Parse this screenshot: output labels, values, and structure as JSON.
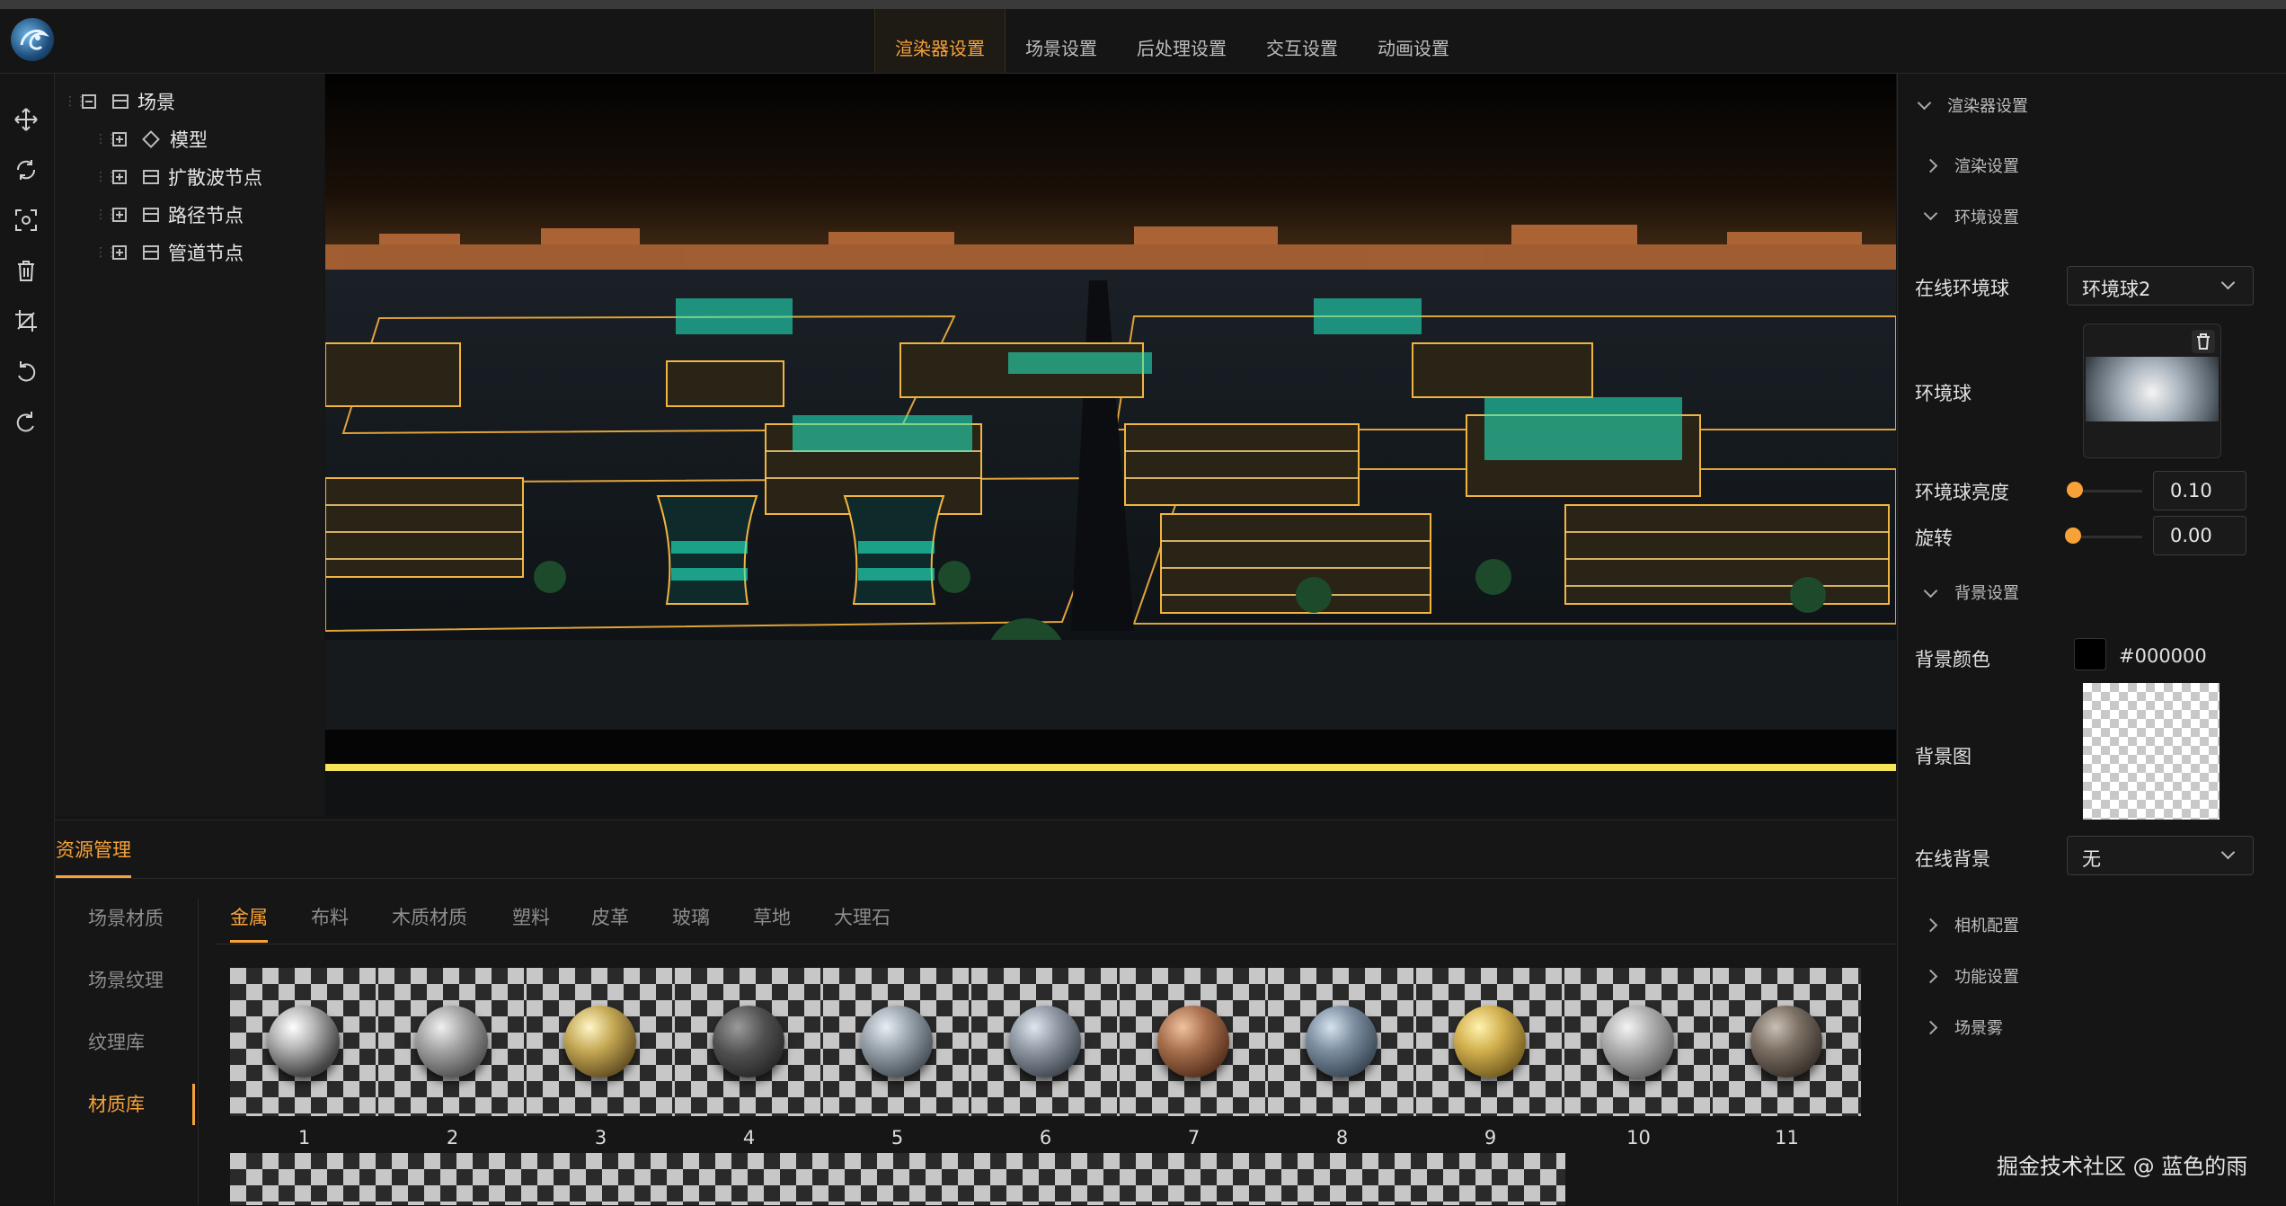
{
  "header": {
    "tabs": [
      {
        "label": "渲染器设置",
        "active": true
      },
      {
        "label": "场景设置"
      },
      {
        "label": "后处理设置"
      },
      {
        "label": "交互设置"
      },
      {
        "label": "动画设置"
      }
    ]
  },
  "toolbar": {
    "tools": [
      "move-icon",
      "rotate-icon",
      "scale-icon",
      "delete-icon",
      "crop-icon",
      "undo-icon",
      "redo-icon"
    ]
  },
  "tree": {
    "root": "场景",
    "children": [
      "模型",
      "扩散波节点",
      "路径节点",
      "管道节点"
    ]
  },
  "resources": {
    "title": "资源管理",
    "side": [
      "场景材质",
      "场景纹理",
      "纹理库",
      "材质库"
    ],
    "active_side": "材质库",
    "tabs": [
      "金属",
      "布料",
      "木质材质",
      "塑料",
      "皮革",
      "玻璃",
      "草地",
      "大理石"
    ],
    "active_tab": "金属",
    "materials": [
      "1",
      "2",
      "3",
      "4",
      "5",
      "6",
      "7",
      "8",
      "9",
      "10",
      "11"
    ]
  },
  "right_panel": {
    "renderer_settings": "渲染器设置",
    "render_settings": "渲染设置",
    "env_settings": "环境设置",
    "online_env_label": "在线环境球",
    "online_env_value": "环境球2",
    "env_ball_label": "环境球",
    "env_brightness_label": "环境球亮度",
    "env_brightness_value": "0.10",
    "rotation_label": "旋转",
    "rotation_value": "0.00",
    "bg_settings": "背景设置",
    "bg_color_label": "背景颜色",
    "bg_color_value": "#000000",
    "bg_image_label": "背景图",
    "online_bg_label": "在线背景",
    "online_bg_value": "无",
    "camera_config": "相机配置",
    "feature_settings": "功能设置",
    "scene_fog": "场景雾"
  },
  "watermark": "掘金技术社区 @ 蓝色的雨",
  "colors": {
    "accent": "#f7a238",
    "background": "#141414"
  }
}
